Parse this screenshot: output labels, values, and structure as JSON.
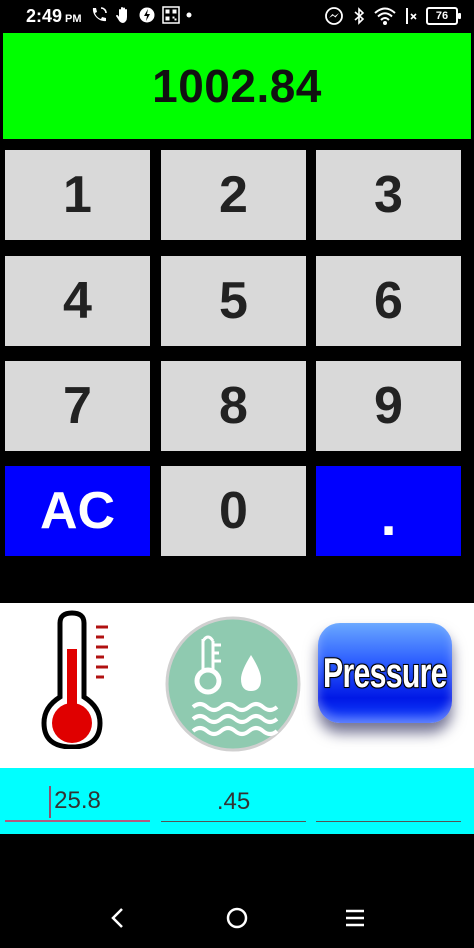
{
  "status_bar": {
    "time": "2:49",
    "ampm": "PM",
    "battery": "76"
  },
  "display": {
    "value": "1002.84",
    "color": "#00ff00"
  },
  "keypad": {
    "keys": [
      {
        "label": "1",
        "style": "gray"
      },
      {
        "label": "2",
        "style": "gray"
      },
      {
        "label": "3",
        "style": "gray"
      },
      {
        "label": "4",
        "style": "gray"
      },
      {
        "label": "5",
        "style": "gray"
      },
      {
        "label": "6",
        "style": "gray"
      },
      {
        "label": "7",
        "style": "gray"
      },
      {
        "label": "8",
        "style": "gray"
      },
      {
        "label": "9",
        "style": "gray"
      },
      {
        "label": "AC",
        "style": "blue"
      },
      {
        "label": "0",
        "style": "gray"
      },
      {
        "label": ".",
        "style": "blue"
      }
    ],
    "key_gray": "#d9d9d9",
    "key_blue": "#0000ff"
  },
  "sensors": {
    "temperature_icon": "thermometer-icon",
    "humidity_icon": "humidity-gauge-icon",
    "pressure_label": "Pressure"
  },
  "fields": {
    "temperature_value": "25.8",
    "humidity_value": ".45",
    "pressure_value": ""
  },
  "colors": {
    "input_row_bg": "#00ffff",
    "humidity_circle": "#8fcab0"
  }
}
